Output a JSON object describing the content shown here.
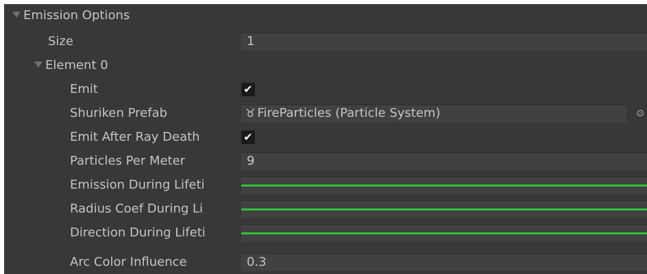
{
  "inspector": {
    "foldout_title": "Emission Options",
    "size_label": "Size",
    "size_value": "1",
    "element_title": "Element 0",
    "emit_label": "Emit",
    "emit_checked": true,
    "shuriken_label": "Shuriken Prefab",
    "shuriken_value": "FireParticles (Particle System)",
    "shuriken_icon": "particle-system-icon",
    "emit_after_label": "Emit After Ray Death",
    "emit_after_checked": true,
    "ppm_label": "Particles Per Meter",
    "ppm_value": "9",
    "emission_curve_label": "Emission During Lifeti",
    "radius_curve_label": "Radius Coef During Li",
    "direction_curve_label": "Direction During Lifeti",
    "arc_label": "Arc Color Influence",
    "arc_value": "0.3",
    "checkmark": "✔",
    "particle_glyph": "♉",
    "picker_glyph": "⊙"
  },
  "colors": {
    "panel_bg": "#383838",
    "field_bg": "#414141",
    "curve_green": "#2ec43a",
    "text": "#c4c4c4"
  }
}
